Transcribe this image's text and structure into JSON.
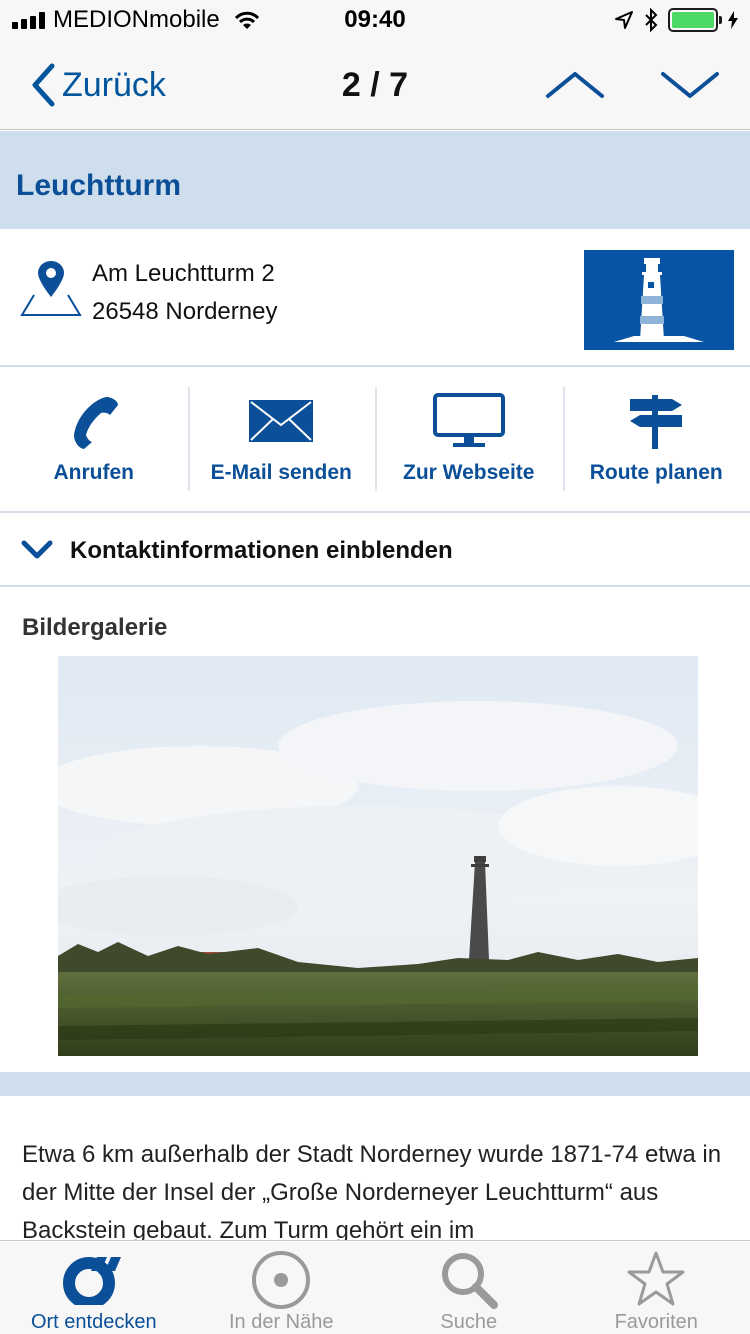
{
  "status_bar": {
    "carrier": "MEDIONmobile",
    "time": "09:40"
  },
  "nav": {
    "back_label": "Zurück",
    "counter": "2 / 7"
  },
  "title": "Leuchtturm",
  "address": {
    "street": "Am Leuchtturm 2",
    "city": "26548 Norderney"
  },
  "actions": [
    {
      "label": "Anrufen",
      "icon": "phone-icon"
    },
    {
      "label": "E-Mail senden",
      "icon": "envelope-icon"
    },
    {
      "label": "Zur Webseite",
      "icon": "monitor-icon"
    },
    {
      "label": "Route planen",
      "icon": "signpost-icon"
    }
  ],
  "contact_toggle_label": "Kontaktinformationen einblenden",
  "gallery": {
    "title": "Bildergalerie"
  },
  "description": "Etwa 6 km außerhalb der Stadt Norderney wurde 1871-74 etwa in der Mitte der Insel der „Große Norderneyer Leuchtturm“ aus Backstein gebaut. Zum Turm gehört ein im",
  "tabs": [
    {
      "label": "Ort entdecken",
      "icon": "logo-icon",
      "active": true
    },
    {
      "label": "In der Nähe",
      "icon": "nearby-icon",
      "active": false
    },
    {
      "label": "Suche",
      "icon": "search-icon",
      "active": false
    },
    {
      "label": "Favoriten",
      "icon": "star-icon",
      "active": false
    }
  ],
  "colors": {
    "accent": "#0a4f98",
    "band": "#cfdeec",
    "battery": "#4cd964"
  }
}
